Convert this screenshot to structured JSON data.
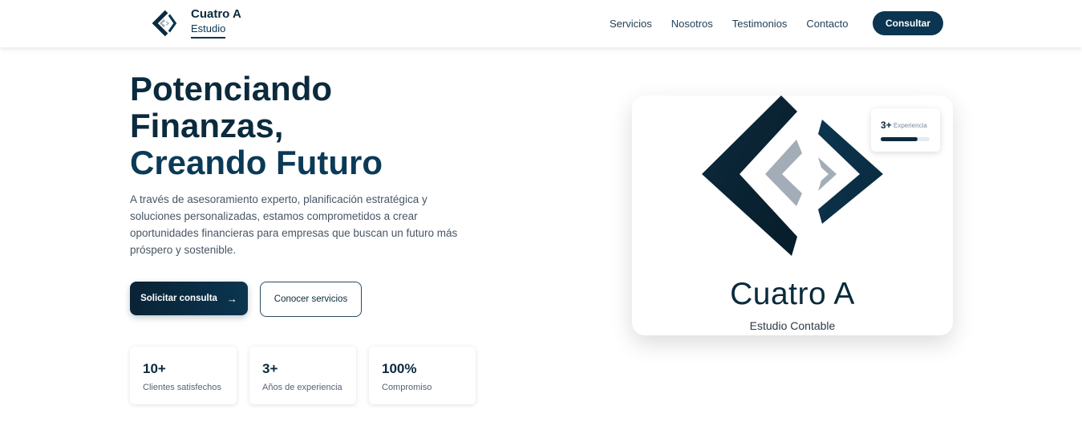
{
  "header": {
    "brand_name": "Cuatro A",
    "brand_sub": "Estudio",
    "nav": [
      "Servicios",
      "Nosotros",
      "Testimonios",
      "Contacto"
    ],
    "cta": "Consultar",
    "logo_icon": "diamond-brackets-logo-icon"
  },
  "hero": {
    "title_line1": "Potenciando",
    "title_line2": "Finanzas,",
    "title_line3": "Creando Futuro",
    "description": "A través de asesoramiento experto, planificación estratégica y soluciones personalizadas, estamos comprometidos a crear oportunidades financieras para empresas que buscan un futuro más próspero y sostenible.",
    "primary_button": "Solicitar consulta",
    "primary_button_icon": "arrow-right-icon",
    "secondary_button": "Conocer servicios"
  },
  "stats": [
    {
      "value": "10+",
      "label": "Clientes satisfechos"
    },
    {
      "value": "3+",
      "label": "Años de experiencia"
    },
    {
      "value": "100%",
      "label": "Compromiso"
    }
  ],
  "card": {
    "name": "Cuatro A",
    "sub": "Estudio Contable",
    "badge_value": "3+",
    "badge_label": "Experiencia",
    "badge_progress": 0.75
  },
  "colors": {
    "primary": "#0b2a3d",
    "accent": "#0b3550",
    "muted_logo": "#a3adb8"
  }
}
